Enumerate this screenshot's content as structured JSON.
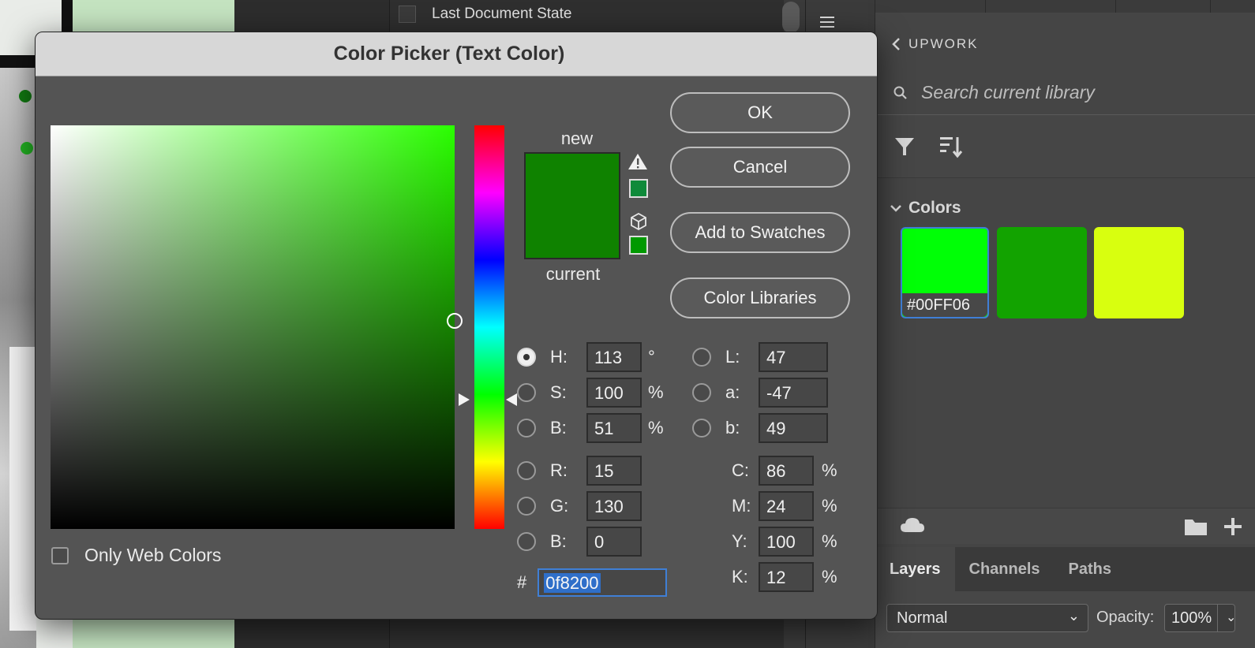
{
  "history": {
    "item_label": "Last Document State"
  },
  "dialog": {
    "title": "Color Picker (Text Color)",
    "new_label": "new",
    "current_label": "current",
    "new_color": "#0f8200",
    "current_color": "#0f8200",
    "gamut_swatch_color": "#0f8a3a",
    "web_swatch_color": "#009900",
    "buttons": {
      "ok": "OK",
      "cancel": "Cancel",
      "add_to_swatches": "Add to Swatches",
      "color_libraries": "Color Libraries"
    },
    "hsb": {
      "h": {
        "label": "H:",
        "value": "113",
        "unit": "°"
      },
      "s": {
        "label": "S:",
        "value": "100",
        "unit": "%"
      },
      "b": {
        "label": "B:",
        "value": "51",
        "unit": "%"
      }
    },
    "rgb": {
      "r": {
        "label": "R:",
        "value": "15"
      },
      "g": {
        "label": "G:",
        "value": "130"
      },
      "b": {
        "label": "B:",
        "value": "0"
      }
    },
    "lab": {
      "l": {
        "label": "L:",
        "value": "47"
      },
      "a": {
        "label": "a:",
        "value": "-47"
      },
      "b": {
        "label": "b:",
        "value": "49"
      }
    },
    "cmyk": {
      "c": {
        "label": "C:",
        "value": "86",
        "unit": "%"
      },
      "m": {
        "label": "M:",
        "value": "24",
        "unit": "%"
      },
      "y": {
        "label": "Y:",
        "value": "100",
        "unit": "%"
      },
      "k": {
        "label": "K:",
        "value": "12",
        "unit": "%"
      }
    },
    "hex": {
      "label": "#",
      "value": "0f8200"
    },
    "only_web_colors": "Only Web Colors"
  },
  "library": {
    "header": "UPWORK",
    "search_placeholder": "Search current library",
    "section_title": "Colors",
    "swatches": [
      {
        "color": "#00ff06",
        "label": "#00FF06"
      },
      {
        "color": "#12a300"
      },
      {
        "color": "#d8ff0f"
      }
    ]
  },
  "layers": {
    "tabs": [
      "Layers",
      "Channels",
      "Paths"
    ],
    "blend_mode": "Normal",
    "opacity_label": "Opacity:",
    "opacity_value": "100%"
  }
}
